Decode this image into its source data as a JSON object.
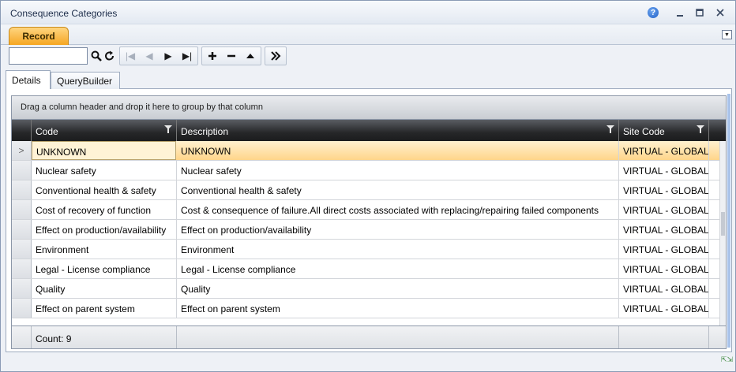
{
  "window": {
    "title": "Consequence Categories"
  },
  "record_tab": {
    "label": "Record"
  },
  "toolbar": {
    "search_value": ""
  },
  "subtabs": [
    {
      "label": "Details"
    },
    {
      "label": "QueryBuilder"
    }
  ],
  "grid": {
    "group_hint": "Drag a column header and drop it here to group by that column",
    "columns": [
      "Code",
      "Description",
      "Site Code"
    ],
    "rows": [
      {
        "code": "UNKNOWN",
        "description": "UNKNOWN",
        "site": "VIRTUAL - GLOBAL"
      },
      {
        "code": "Nuclear safety",
        "description": "Nuclear safety",
        "site": "VIRTUAL - GLOBAL"
      },
      {
        "code": "Conventional health & safety",
        "description": "Conventional health & safety",
        "site": "VIRTUAL - GLOBAL"
      },
      {
        "code": "Cost of recovery of function",
        "description": "Cost & consequence of failure.All direct costs associated with replacing/repairing failed components",
        "site": "VIRTUAL - GLOBAL"
      },
      {
        "code": "Effect on production/availability",
        "description": "Effect on production/availability",
        "site": "VIRTUAL - GLOBAL"
      },
      {
        "code": "Environment",
        "description": "Environment",
        "site": "VIRTUAL - GLOBAL"
      },
      {
        "code": "Legal - License compliance",
        "description": "Legal - License compliance",
        "site": "VIRTUAL - GLOBAL"
      },
      {
        "code": "Quality",
        "description": "Quality",
        "site": "VIRTUAL - GLOBAL"
      },
      {
        "code": "Effect on parent system",
        "description": "Effect on parent system",
        "site": "VIRTUAL - GLOBAL"
      }
    ],
    "selected_indicator": ">",
    "count_label": "Count: 9"
  }
}
